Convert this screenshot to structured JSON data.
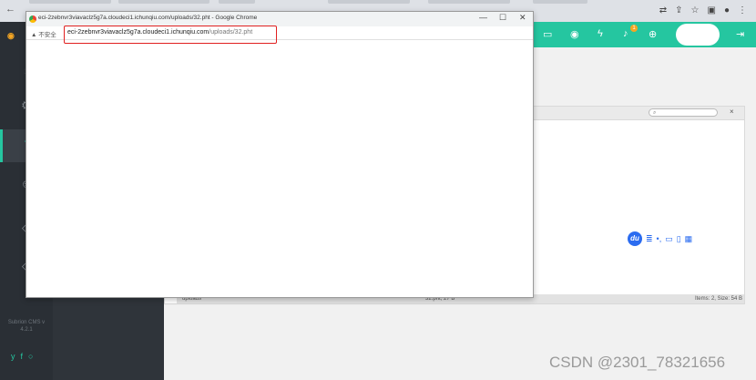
{
  "popup": {
    "title": "eci-2zebnvr3viavaclz5g7a.cloudeci1.ichunqiu.com/uploads/32.pht - Google Chrome",
    "insecure_label": "不安全",
    "url_host": "eci-2zebnvr3viavaclz5g7a.cloudeci1.ichunqiu.com",
    "url_path": "/uploads/32.pht",
    "minimize": "—",
    "maximize": "☐",
    "close": "✕"
  },
  "file_manager": {
    "search_placeholder": "⌕",
    "close": "×",
    "status_path": "uploads",
    "status_file": "32.pht, 27 B",
    "status_items": "Items: 2, Size: 54 B"
  },
  "sidebar": {
    "version": "Subrion CMS v 4.2.1",
    "items": [
      {
        "icon": "dashboard-icon"
      },
      {
        "icon": "extensions-icon"
      },
      {
        "icon": "content-icon"
      },
      {
        "icon": "members-icon"
      },
      {
        "icon": "financial-icon"
      },
      {
        "icon": "system-icon"
      }
    ]
  },
  "topbar": {
    "badge": "1"
  },
  "watermark": "CSDN @2301_78321656",
  "colors": {
    "accent": "#25c6a0",
    "highlight": "#e02020",
    "sidebar": "#2a2f35"
  }
}
